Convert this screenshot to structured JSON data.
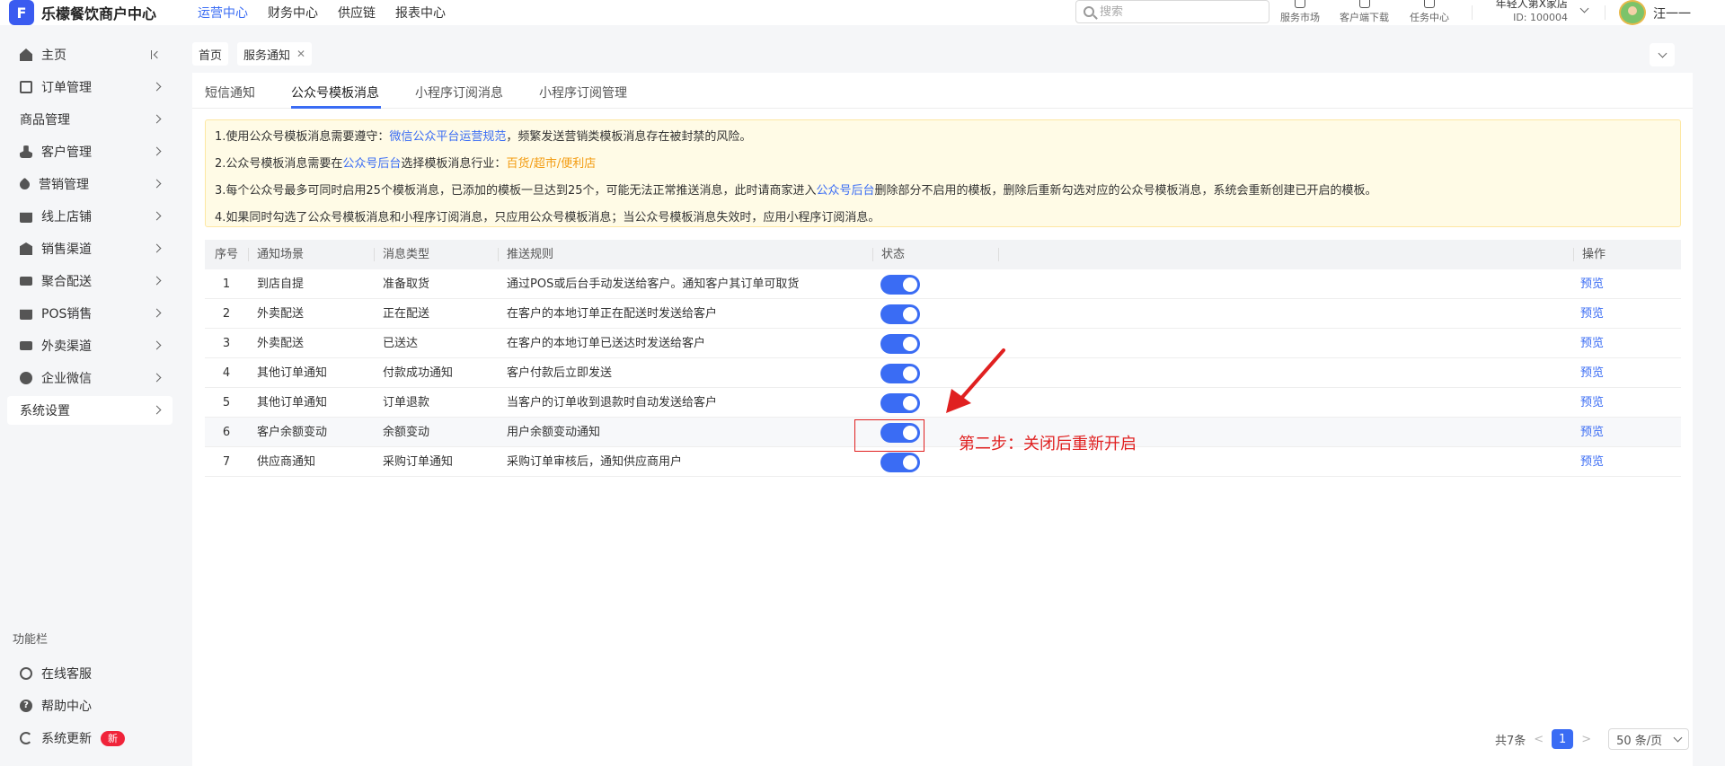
{
  "app": {
    "logo_mark": "F",
    "title": "乐檬餐饮商户中心"
  },
  "topnav": [
    {
      "label": "运营中心",
      "active": true
    },
    {
      "label": "财务中心"
    },
    {
      "label": "供应链"
    },
    {
      "label": "报表中心"
    }
  ],
  "search": {
    "placeholder": "搜索",
    "value": ""
  },
  "header_tools": [
    {
      "label": "服务市场",
      "icon": "market-icon"
    },
    {
      "label": "客户端下载",
      "icon": "download-icon"
    },
    {
      "label": "任务中心",
      "icon": "task-icon"
    }
  ],
  "store": {
    "name": "年轻人第X家店",
    "id": "ID: 100004"
  },
  "user": {
    "name": "汪一一"
  },
  "sidebar": {
    "items": [
      {
        "label": "主页",
        "icon": "home-icon"
      },
      {
        "label": "订单管理",
        "icon": "order-icon"
      },
      {
        "label": "商品管理",
        "icon": ""
      },
      {
        "label": "客户管理",
        "icon": "customer-icon"
      },
      {
        "label": "营销管理",
        "icon": "tag-icon"
      },
      {
        "label": "线上店铺",
        "icon": "shop-icon"
      },
      {
        "label": "销售渠道",
        "icon": "bank-icon"
      },
      {
        "label": "聚合配送",
        "icon": "truck-icon"
      },
      {
        "label": "POS销售",
        "icon": "pos-icon"
      },
      {
        "label": "外卖渠道",
        "icon": "delivery-icon"
      },
      {
        "label": "企业微信",
        "icon": "wechat-icon"
      },
      {
        "label": "系统设置",
        "icon": "",
        "active": true
      }
    ],
    "func_label": "功能栏",
    "func_items": [
      {
        "label": "在线客服",
        "icon": "headset-icon"
      },
      {
        "label": "帮助中心",
        "icon": "help-icon"
      },
      {
        "label": "系统更新",
        "icon": "refresh-icon",
        "badge": "新"
      }
    ]
  },
  "page_tabs": [
    {
      "label": "首页"
    },
    {
      "label": "服务通知",
      "closable": true,
      "active": true
    }
  ],
  "sub_tabs": [
    {
      "label": "短信通知"
    },
    {
      "label": "公众号模板消息",
      "active": true
    },
    {
      "label": "小程序订阅消息"
    },
    {
      "label": "小程序订阅管理"
    }
  ],
  "notice": {
    "line1_pre": "1.使用公众号模板消息需要遵守：",
    "line1_link": "微信公众平台运营规范",
    "line1_post": "，频繁发送营销类模板消息存在被封禁的风险。",
    "line2_pre": "2.公众号模板消息需要在",
    "line2_link": "公众号后台",
    "line2_mid": "选择模板消息行业：",
    "line2_value": "百货/超市/便利店",
    "line3_pre": "3.每个公众号最多可同时启用25个模板消息，已添加的模板一旦达到25个，可能无法正常推送消息，此时请商家进入",
    "line3_link": "公众号后台",
    "line3_post": "删除部分不启用的模板，删除后重新勾选对应的公众号模板消息，系统会重新创建已开启的模板。",
    "line4": "4.如果同时勾选了公众号模板消息和小程序订阅消息，只应用公众号模板消息；当公众号模板消息失效时，应用小程序订阅消息。"
  },
  "table": {
    "columns": [
      "序号",
      "通知场景",
      "消息类型",
      "推送规则",
      "状态",
      "操作"
    ],
    "rows": [
      {
        "no": "1",
        "scene": "到店自提",
        "type": "准备取货",
        "rule": "通过POS或后台手动发送给客户。通知客户其订单可取货",
        "enabled": true,
        "action": "预览"
      },
      {
        "no": "2",
        "scene": "外卖配送",
        "type": "正在配送",
        "rule": "在客户的本地订单正在配送时发送给客户",
        "enabled": true,
        "action": "预览"
      },
      {
        "no": "3",
        "scene": "外卖配送",
        "type": "已送达",
        "rule": "在客户的本地订单已送达时发送给客户",
        "enabled": true,
        "action": "预览"
      },
      {
        "no": "4",
        "scene": "其他订单通知",
        "type": "付款成功通知",
        "rule": "客户付款后立即发送",
        "enabled": true,
        "action": "预览"
      },
      {
        "no": "5",
        "scene": "其他订单通知",
        "type": "订单退款",
        "rule": "当客户的订单收到退款时自动发送给客户",
        "enabled": true,
        "action": "预览"
      },
      {
        "no": "6",
        "scene": "客户余额变动",
        "type": "余额变动",
        "rule": "用户余额变动通知",
        "enabled": true,
        "action": "预览"
      },
      {
        "no": "7",
        "scene": "供应商通知",
        "type": "采购订单通知",
        "rule": "采购订单审核后，通知供应商用户",
        "enabled": true,
        "action": "预览"
      }
    ]
  },
  "annotation": {
    "text": "第二步：关闭后重新开启",
    "color": "#e02020"
  },
  "pagination": {
    "total": "共7条",
    "current": "1",
    "page_size": "50 条/页"
  },
  "colors": {
    "accent": "#3a6cf4",
    "notice_bg": "#fffbe6",
    "highlight": "#f39c12"
  }
}
